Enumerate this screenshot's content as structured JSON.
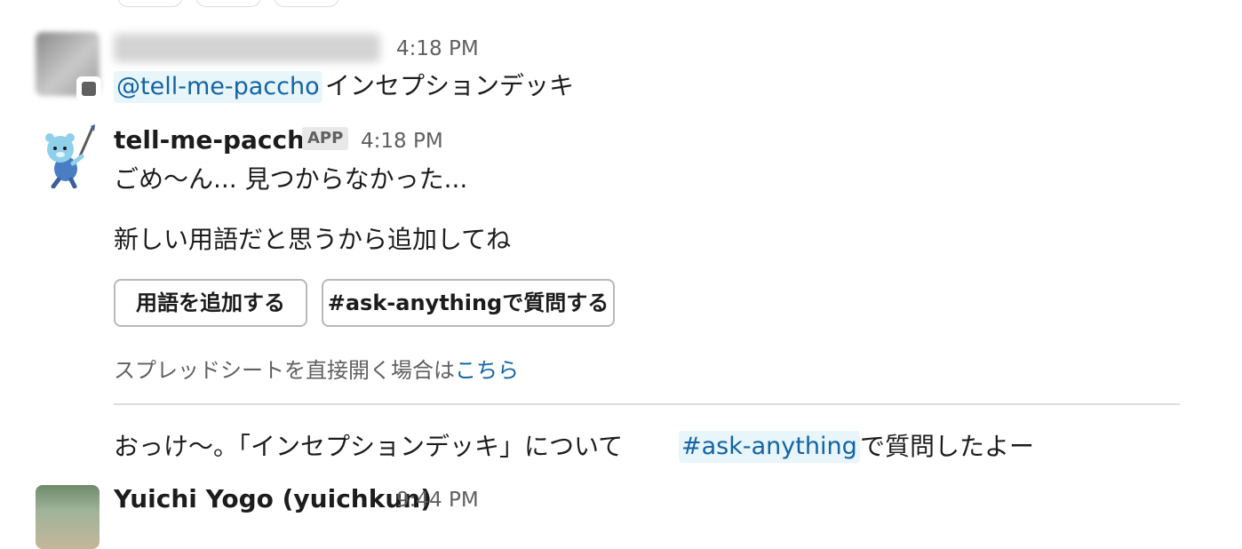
{
  "messages": [
    {
      "time": "4:18 PM",
      "mention": "@tell-me-paccho",
      "text": "インセプションデッキ"
    },
    {
      "sender": "tell-me-paccho",
      "badge": "APP",
      "time": "4:18 PM",
      "line1": "ごめ〜ん... 見つからなかった...",
      "line2": "新しい用語だと思うから追加してね",
      "buttons": [
        "用語を追加する",
        "#ask-anythingで質問する"
      ],
      "meta_text": "スプレッドシートを直接開く場合は",
      "meta_link": "こちら",
      "followup_before": "おっけ〜。「インセプションデッキ」について",
      "followup_channel": "#ask-anything",
      "followup_after": "で質問したよー"
    },
    {
      "sender": "Yuichi Yogo (yuichkun)",
      "time": "9:44 PM"
    }
  ],
  "colors": {
    "link": "#1264a3",
    "mention_bg": "#e8f5fa",
    "muted": "#616061"
  },
  "icons": {
    "bot_avatar": "bear-with-brush-icon"
  }
}
